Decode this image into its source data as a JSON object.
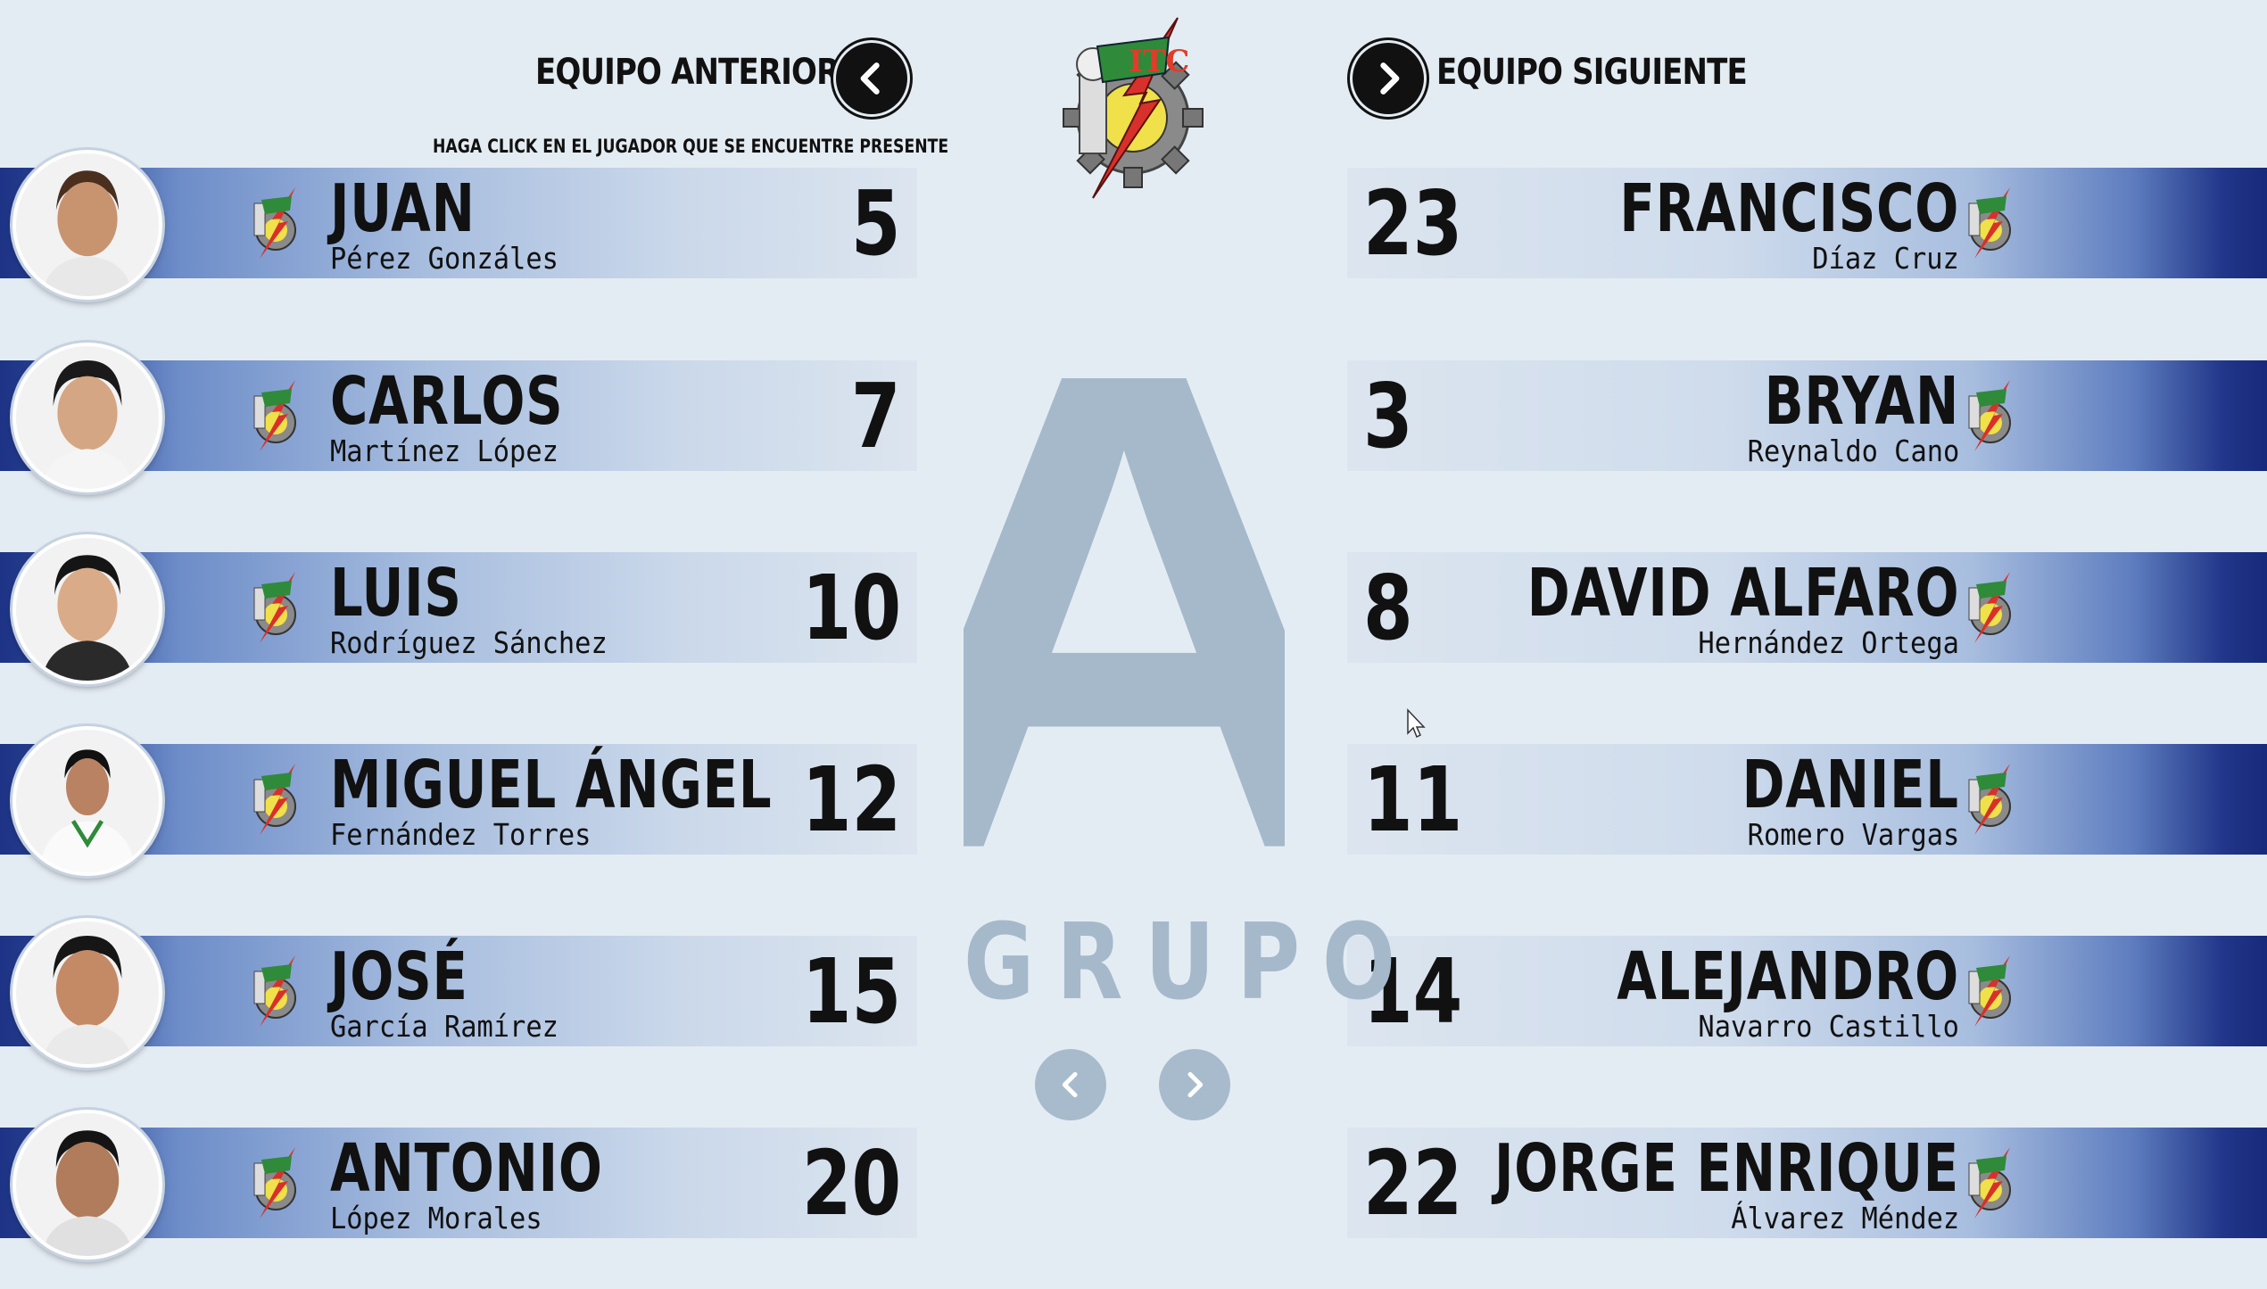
{
  "nav": {
    "prev_team_label": "EQUIPO ANTERIOR",
    "next_team_label": "EQUIPO SIGUIENTE",
    "instruction": "HAGA CLICK EN EL JUGADOR QUE SE ENCUENTRE PRESENTE"
  },
  "logo": {
    "name": "itc-logo"
  },
  "group": {
    "letter": "A",
    "label": "GRUPO"
  },
  "left_team": [
    {
      "first": "JUAN",
      "last": "Pérez Gonzáles",
      "number": "5"
    },
    {
      "first": "CARLOS",
      "last": "Martínez López",
      "number": "7"
    },
    {
      "first": "LUIS",
      "last": "Rodríguez Sánchez",
      "number": "10"
    },
    {
      "first": "MIGUEL ÁNGEL",
      "last": "Fernández Torres",
      "number": "12"
    },
    {
      "first": "JOSÉ",
      "last": "García Ramírez",
      "number": "15"
    },
    {
      "first": "ANTONIO",
      "last": "López Morales",
      "number": "20"
    }
  ],
  "right_team": [
    {
      "first": "FRANCISCO",
      "last": "Díaz Cruz",
      "number": "23"
    },
    {
      "first": "BRYAN",
      "last": "Reynaldo Cano",
      "number": "3"
    },
    {
      "first": "DAVID ALFARO",
      "last": "Hernández Ortega",
      "number": "8"
    },
    {
      "first": "DANIEL",
      "last": "Romero Vargas",
      "number": "11"
    },
    {
      "first": "ALEJANDRO",
      "last": "Navarro Castillo",
      "number": "14"
    },
    {
      "first": "JORGE ENRIQUE",
      "last": "Álvarez Méndez",
      "number": "22"
    }
  ],
  "colors": {
    "background": "#e4ecf3",
    "row_dark": "#1e3385",
    "row_light": "#dce5ef",
    "group_gray": "#a5b9cb"
  },
  "icons": {
    "prev_team": "chevron-left-icon",
    "next_team": "chevron-right-icon",
    "emblem": "team-emblem-icon",
    "cursor": "mouse-cursor-icon"
  }
}
